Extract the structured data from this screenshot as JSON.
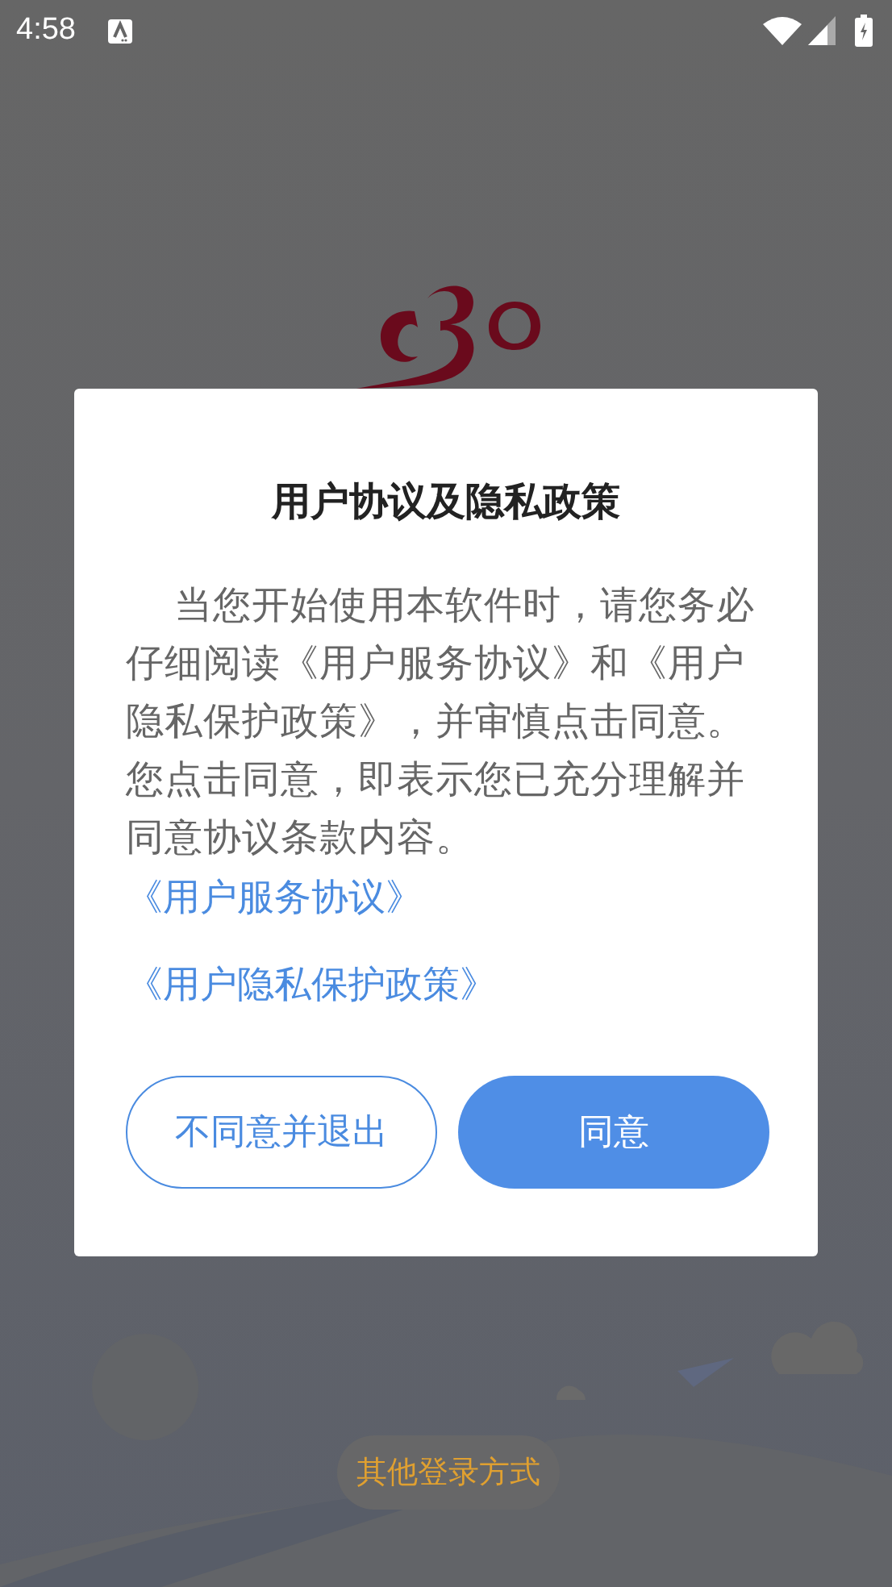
{
  "status_bar": {
    "time": "4:58"
  },
  "dialog": {
    "title": "用户协议及隐私政策",
    "message": "当您开始使用本软件时，请您务必仔细阅读《用户服务协议》和《用户隐私保护政策》，并审慎点击同意。您点击同意，即表示您已充分理解并同意协议条款内容。",
    "links": [
      "《用户服务协议》",
      "《用户隐私保护政策》"
    ],
    "buttons": [
      {
        "label": "不同意并退出",
        "kind": "outline"
      },
      {
        "label": "同意",
        "kind": "filled"
      }
    ]
  },
  "other_login": {
    "label": "其他登录方式"
  }
}
